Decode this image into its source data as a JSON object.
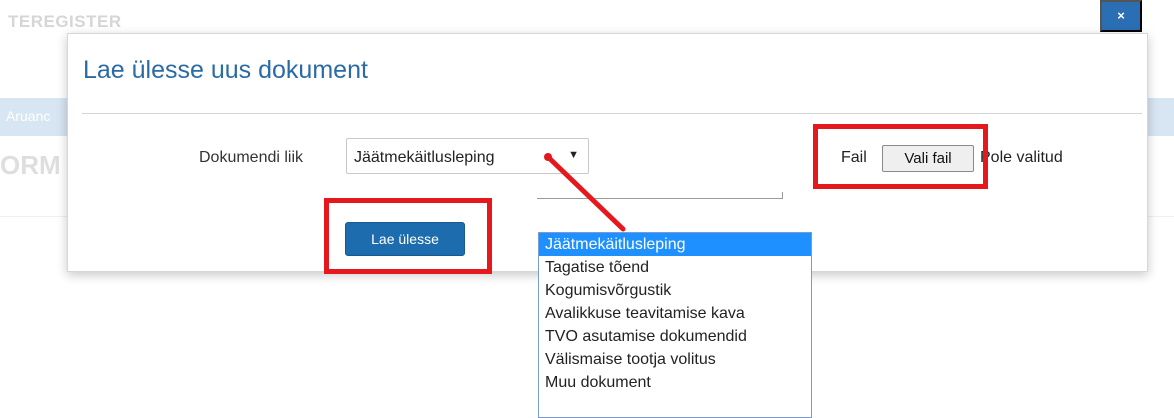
{
  "background": {
    "title": "TEREGISTER",
    "bar_text": "Aruanc",
    "heading_fragment": "ORM",
    "close_label": "×"
  },
  "modal": {
    "title": "Lae ülesse uus dokument",
    "document_type": {
      "label": "Dokumendi liik",
      "selected": "Jäätmekäitlusleping",
      "arrow": "▼"
    },
    "file": {
      "label": "Fail",
      "button": "Vali fail",
      "status": "Pole valitud"
    },
    "upload_button": "Lae ülesse"
  },
  "dropdown": {
    "options": [
      "Jäätmekäitlusleping",
      "Tagatise tõend",
      "Kogumisvõrgustik",
      "Avalikkuse teavitamise kava",
      "TVO asutamise dokumendid",
      "Välismaise tootja volitus",
      "Muu dokument"
    ],
    "selected_index": 0
  },
  "colors": {
    "accent": "#1d6cad",
    "title": "#2a6ba5",
    "annotation": "#e5181e",
    "dropdown_highlight": "#1e90ff"
  }
}
